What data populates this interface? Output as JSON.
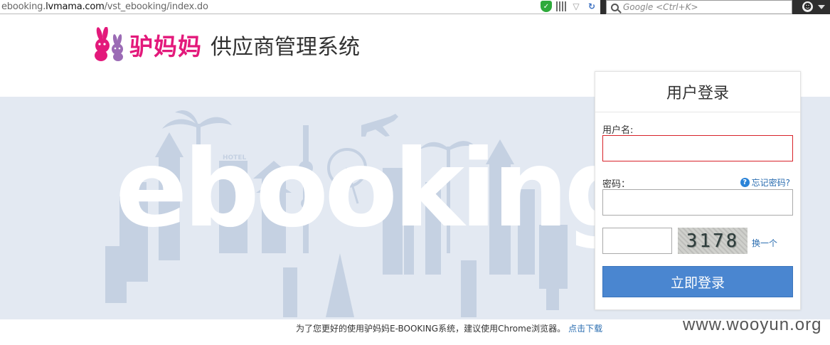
{
  "browser": {
    "url_prefix": "ebooking.",
    "url_domain": "lvmama.com",
    "url_path": "/vst_ebooking/index.do",
    "search_placeholder": "Google <Ctrl+K>"
  },
  "header": {
    "brand": "驴妈妈",
    "system_title": "供应商管理系统"
  },
  "banner": {
    "word": "ebooking",
    "hotel_sign": "HOTEL"
  },
  "login": {
    "title": "用户登录",
    "username_label": "用户名:",
    "username_value": "",
    "password_label": "密码：",
    "password_value": "",
    "forgot_label": "忘记密码?",
    "captcha_value": "",
    "captcha_text": "3178",
    "refresh_label": "换一个",
    "submit_label": "立即登录"
  },
  "footer": {
    "tip": "为了您更好的使用驴妈妈E-BOOKING系统，建议使用Chrome浏览器。",
    "download_label": "点击下载"
  },
  "watermark": "www.wooyun.org",
  "colors": {
    "brand_pink": "#e3197b",
    "banner_bg": "#e3e9f2",
    "submit_blue": "#4a86d0",
    "link_blue": "#2a6db0",
    "error_red": "#d8232a"
  }
}
